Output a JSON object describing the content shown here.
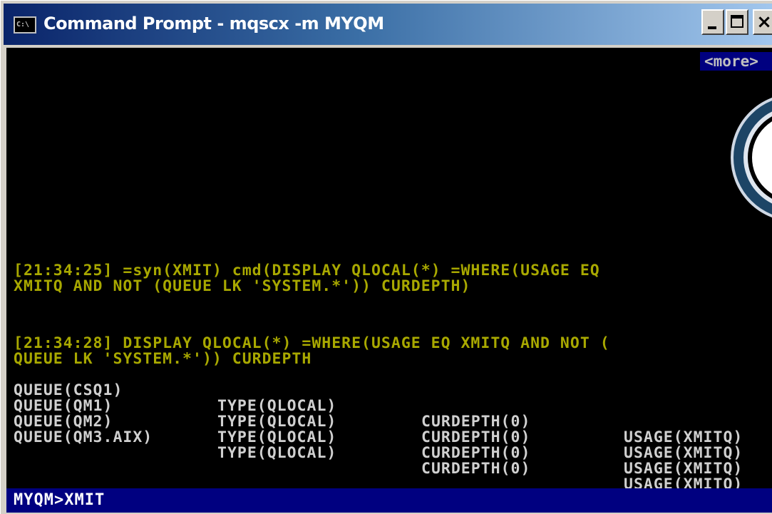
{
  "window": {
    "title": "Command Prompt - mqscx  -m MYQM",
    "icon_label": "C:\\",
    "icon": "console-app-icon"
  },
  "controls": {
    "minimize": "_",
    "close": "×"
  },
  "console": {
    "more_indicator": "<more>",
    "command_echo": [
      "[21:34:25] =syn(XMIT) cmd(DISPLAY QLOCAL(*) =WHERE(USAGE EQ",
      "XMITQ AND NOT (QUEUE LK 'SYSTEM.*')) CURDEPTH)"
    ],
    "command_run": [
      "[21:34:28] DISPLAY QLOCAL(*) =WHERE(USAGE EQ XMITQ AND NOT (",
      "QUEUE LK 'SYSTEM.*')) CURDEPTH"
    ],
    "results": [
      [
        "QUEUE(CSQ1)",
        "TYPE(QLOCAL)",
        "CURDEPTH(0)",
        "USAGE(XMITQ)"
      ],
      [
        "QUEUE(QM1)",
        "TYPE(QLOCAL)",
        "CURDEPTH(0)",
        "USAGE(XMITQ)"
      ],
      [
        "QUEUE(QM2)",
        "TYPE(QLOCAL)",
        "CURDEPTH(0)",
        "USAGE(XMITQ)"
      ],
      [
        "QUEUE(QM3.AIX)",
        "TYPE(QLOCAL)",
        "CURDEPTH(0)",
        "USAGE(XMITQ)"
      ]
    ]
  },
  "prompt": {
    "text": "MYQM>XMIT"
  },
  "colors": {
    "echo_text": "#a8a800",
    "result_text": "#d0d0d0",
    "prompt_bar": "#000080",
    "titlebar_start": "#0a246a"
  }
}
